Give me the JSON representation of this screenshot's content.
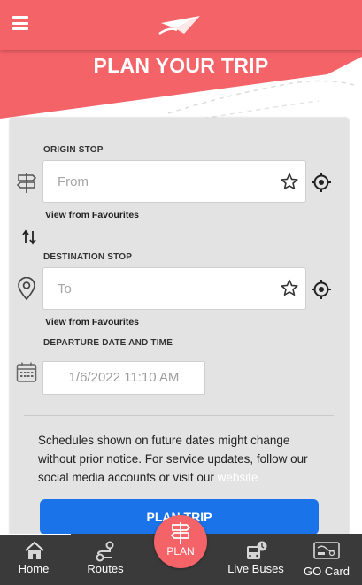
{
  "header": {
    "menu_icon": "hamburger-icon",
    "logo_icon": "paper-plane-logo"
  },
  "hero": {
    "title": "PLAN YOUR TRIP"
  },
  "form": {
    "origin": {
      "label": "ORIGIN STOP",
      "placeholder": "From",
      "favourites_link": "View from Favourites",
      "icon": "signpost-icon"
    },
    "destination": {
      "label": "DESTINATION STOP",
      "placeholder": "To",
      "favourites_link": "View from Favourites",
      "icon": "map-pin-icon"
    },
    "swap_icon": "swap-arrows-icon",
    "departure": {
      "label": "DEPARTURE DATE AND TIME",
      "value": "1/6/2022 11:10 AM",
      "icon": "calendar-icon"
    },
    "notice": {
      "text": "Schedules shown on future dates might change without prior notice. For service updates, follow our social media accounts or visit our ",
      "link": "website"
    },
    "plan_button": "PLAN TRIP"
  },
  "nav": {
    "home": "Home",
    "routes": "Routes",
    "plan": "PLAN",
    "live_buses": "Live Buses",
    "go_card": "GO Card"
  },
  "colors": {
    "brand": "#f46368",
    "primary_button": "#1a73e8",
    "nav_background": "#3a3a3a",
    "card_background": "#e3e3e3"
  }
}
